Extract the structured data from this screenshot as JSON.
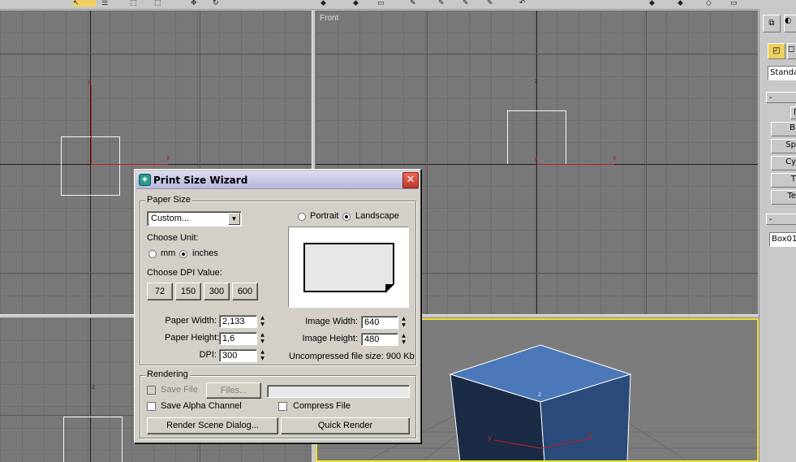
{
  "viewports": {
    "front_label": "Front",
    "axis_labels": {
      "x": "x",
      "y": "y",
      "z": "z"
    }
  },
  "command_panel": {
    "dropdown_value": "Standa",
    "rollout_minus": "-",
    "buttons": [
      "Г",
      "B",
      "Sp",
      "Cy",
      "T",
      "Te"
    ],
    "name_field": "Box01"
  },
  "dialog": {
    "title": "Print Size Wizard",
    "close_glyph": "✕",
    "paper_size": {
      "group_title": "Paper Size",
      "preset_value": "Custom...",
      "orientation_portrait": "Portrait",
      "orientation_landscape": "Landscape",
      "orientation_selected": "Landscape",
      "choose_unit_label": "Choose Unit:",
      "unit_mm": "mm",
      "unit_inches": "inches",
      "unit_selected": "inches",
      "choose_dpi_label": "Choose DPI Value:",
      "dpi_buttons": [
        "72",
        "150",
        "300",
        "600"
      ],
      "paper_width_label": "Paper Width:",
      "paper_width_value": "2,133",
      "paper_height_label": "Paper Height:",
      "paper_height_value": "1,6",
      "dpi_label": "DPI:",
      "dpi_value": "300",
      "image_width_label": "Image Width:",
      "image_width_value": "640",
      "image_height_label": "Image Height:",
      "image_height_value": "480",
      "file_size_text": "Uncompressed file size: 900 Kb"
    },
    "rendering": {
      "group_title": "Rendering",
      "save_file_label": "Save File",
      "files_button": "Files...",
      "file_path_value": "",
      "save_alpha_label": "Save Alpha Channel",
      "compress_label": "Compress File",
      "render_scene_button": "Render Scene Dialog...",
      "quick_render_button": "Quick Render"
    }
  },
  "colors": {
    "viewport_bg": "#787878",
    "active_viewport_border": "#f0e030",
    "cube_front": "#1b2a45",
    "cube_top": "#4a78b8",
    "cube_right": "#2a4a7a"
  }
}
